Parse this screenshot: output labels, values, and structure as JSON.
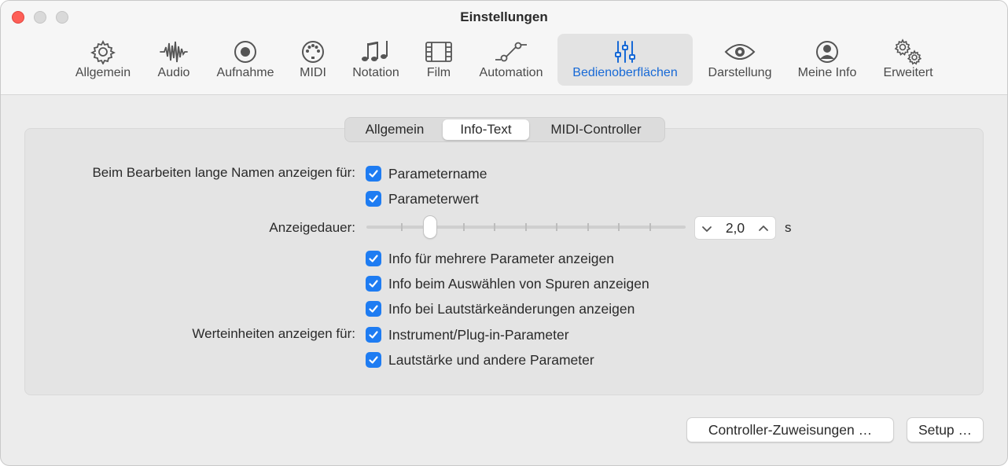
{
  "window": {
    "title": "Einstellungen"
  },
  "toolbar": {
    "items": [
      {
        "label": "Allgemein",
        "icon": "gear-icon"
      },
      {
        "label": "Audio",
        "icon": "waveform-icon"
      },
      {
        "label": "Aufnahme",
        "icon": "record-icon"
      },
      {
        "label": "MIDI",
        "icon": "midi-icon"
      },
      {
        "label": "Notation",
        "icon": "notes-icon"
      },
      {
        "label": "Film",
        "icon": "film-icon"
      },
      {
        "label": "Automation",
        "icon": "automation-icon"
      },
      {
        "label": "Bedienoberflächen",
        "icon": "sliders-icon",
        "selected": true
      },
      {
        "label": "Darstellung",
        "icon": "eye-icon"
      },
      {
        "label": "Meine Info",
        "icon": "person-icon"
      },
      {
        "label": "Erweitert",
        "icon": "gears-icon"
      }
    ],
    "accent_color": "#1769d6"
  },
  "tabs": [
    {
      "label": "Allgemein"
    },
    {
      "label": "Info-Text",
      "selected": true
    },
    {
      "label": "MIDI-Controller"
    }
  ],
  "settings": {
    "long_names_label": "Beim Bearbeiten lange Namen anzeigen für:",
    "parametername": {
      "label": "Parametername",
      "checked": true
    },
    "parameterwert": {
      "label": "Parameterwert",
      "checked": true
    },
    "duration_label": "Anzeigedauer:",
    "duration_value": "2,0",
    "duration_unit": "s",
    "multi_param": {
      "label": "Info für mehrere Parameter anzeigen",
      "checked": true
    },
    "track_select": {
      "label": "Info beim Auswählen von Spuren anzeigen",
      "checked": true
    },
    "volume_change": {
      "label": "Info bei Lautstärkeänderungen anzeigen",
      "checked": true
    },
    "units_label": "Werteinheiten anzeigen für:",
    "instrument_params": {
      "label": "Instrument/Plug-in-Parameter",
      "checked": true
    },
    "volume_params": {
      "label": "Lautstärke und andere Parameter",
      "checked": true
    },
    "checkbox_color": "#1e7cf2"
  },
  "buttons": {
    "controller_assignments": "Controller-Zuweisungen …",
    "setup": "Setup …"
  }
}
